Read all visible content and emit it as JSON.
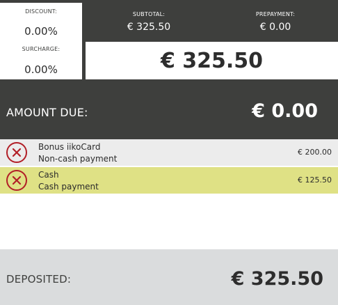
{
  "adjustments": {
    "discount_label": "DISCOUNT:",
    "discount_value": "0.00%",
    "surcharge_label": "SURCHARGE:",
    "surcharge_value": "0.00%"
  },
  "summary": {
    "subtotal_label": "SUBTOTAL:",
    "subtotal_value": "€ 325.50",
    "prepayment_label": "PREPAYMENT:",
    "prepayment_value": "€ 0.00",
    "total_value": "€ 325.50"
  },
  "amount_due": {
    "label": "AMOUNT DUE:",
    "value": "€ 0.00"
  },
  "payments": [
    {
      "name": "Bonus iikoCard",
      "type": "Non-cash payment",
      "amount": "€ 200.00",
      "remove_icon": "remove-circle-x-icon"
    },
    {
      "name": "Cash",
      "type": "Cash payment",
      "amount": "€ 125.50",
      "remove_icon": "remove-circle-x-icon",
      "highlight_color": "#dfe185"
    }
  ],
  "deposited": {
    "label": "DEPOSITED:",
    "value": "€ 325.50"
  },
  "colors": {
    "dark_background": "#3e3f3d",
    "remove_red": "#b21f27",
    "selected_row": "#dfe185",
    "deposited_background": "#dadcdd"
  }
}
